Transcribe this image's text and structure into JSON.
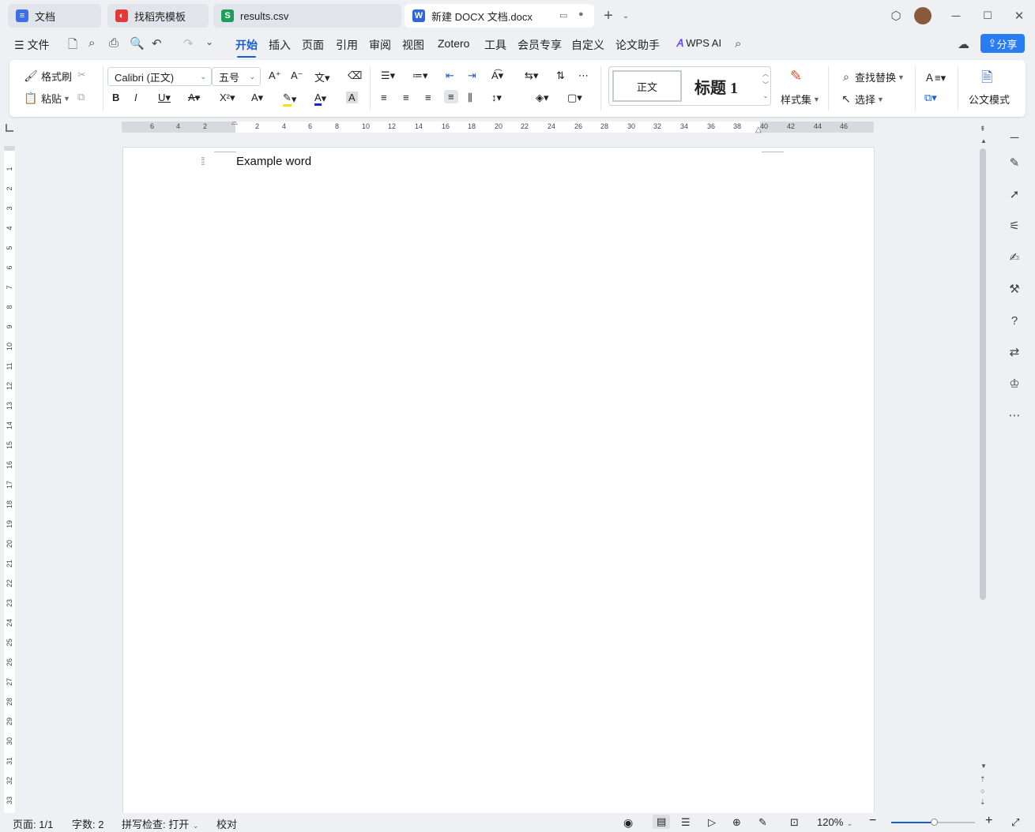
{
  "tabs": [
    {
      "label": "文档",
      "icon": "docs-icon",
      "color": "#3b6fe3"
    },
    {
      "label": "找稻壳模板",
      "icon": "daoke-icon",
      "color": "#e03a3a"
    },
    {
      "label": "results.csv",
      "icon": "sheet-icon",
      "color": "#1d9d5b"
    },
    {
      "label": "新建 DOCX 文档.docx",
      "icon": "word-icon",
      "color": "#2f66e0"
    }
  ],
  "menu": {
    "file": "文件",
    "items": [
      "开始",
      "插入",
      "页面",
      "引用",
      "审阅",
      "视图",
      "Zotero",
      "工具",
      "会员专享",
      "自定义",
      "论文助手"
    ],
    "wps_ai": "WPS AI",
    "share": "分享",
    "active_color": "#1a5fd1"
  },
  "ribbon": {
    "format_painter": "格式刷",
    "paste": "粘贴",
    "font_name": "Calibri (正文)",
    "font_size": "五号",
    "style_normal": "正文",
    "style_heading": "标题 1",
    "style_set": "样式集",
    "find_replace": "查找替换",
    "select": "选择",
    "official_mode": "公文模式"
  },
  "ruler": {
    "h_ticks": [
      "6",
      "4",
      "2",
      "2",
      "4",
      "6",
      "8",
      "10",
      "12",
      "14",
      "16",
      "18",
      "20",
      "22",
      "24",
      "26",
      "28",
      "30",
      "32",
      "34",
      "36",
      "38",
      "40",
      "42",
      "44",
      "46"
    ],
    "v_ticks": [
      "1",
      "2",
      "3",
      "4",
      "5",
      "6",
      "7",
      "8",
      "9",
      "10",
      "11",
      "12",
      "13",
      "14",
      "15",
      "16",
      "17",
      "18",
      "19",
      "20",
      "21",
      "22",
      "23",
      "24",
      "25",
      "26",
      "27",
      "28",
      "29",
      "30",
      "31",
      "32",
      "33"
    ]
  },
  "document": {
    "text": "Example word"
  },
  "status": {
    "page": "页面: 1/1",
    "words": "字数: 2",
    "spell": "拼写检查: 打开",
    "proof": "校对",
    "zoom": "120%"
  }
}
